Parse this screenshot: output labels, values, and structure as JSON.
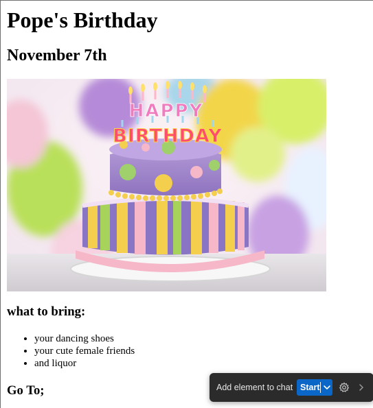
{
  "page": {
    "title": "Pope's Birthday",
    "date": "November 7th",
    "hero_image": {
      "alt": "Birthday cake with HAPPY BIRTHDAY candles in front of balloons",
      "topper_line1": "HAPPY",
      "topper_line2": "BIRTHDAY"
    },
    "bring_heading": "what to bring:",
    "bring_items": [
      "your dancing shoes",
      "your cute female friends",
      "and liquor"
    ],
    "goto_heading": "Go To;"
  },
  "toolbar": {
    "label": "Add element to chat",
    "start_label": "Start",
    "settings_icon": "gear-icon",
    "expand_icon": "chevron-right-icon",
    "dropdown_icon": "chevron-down-icon",
    "accent_color": "#0a67c8",
    "background_color": "#2b2b2b"
  }
}
